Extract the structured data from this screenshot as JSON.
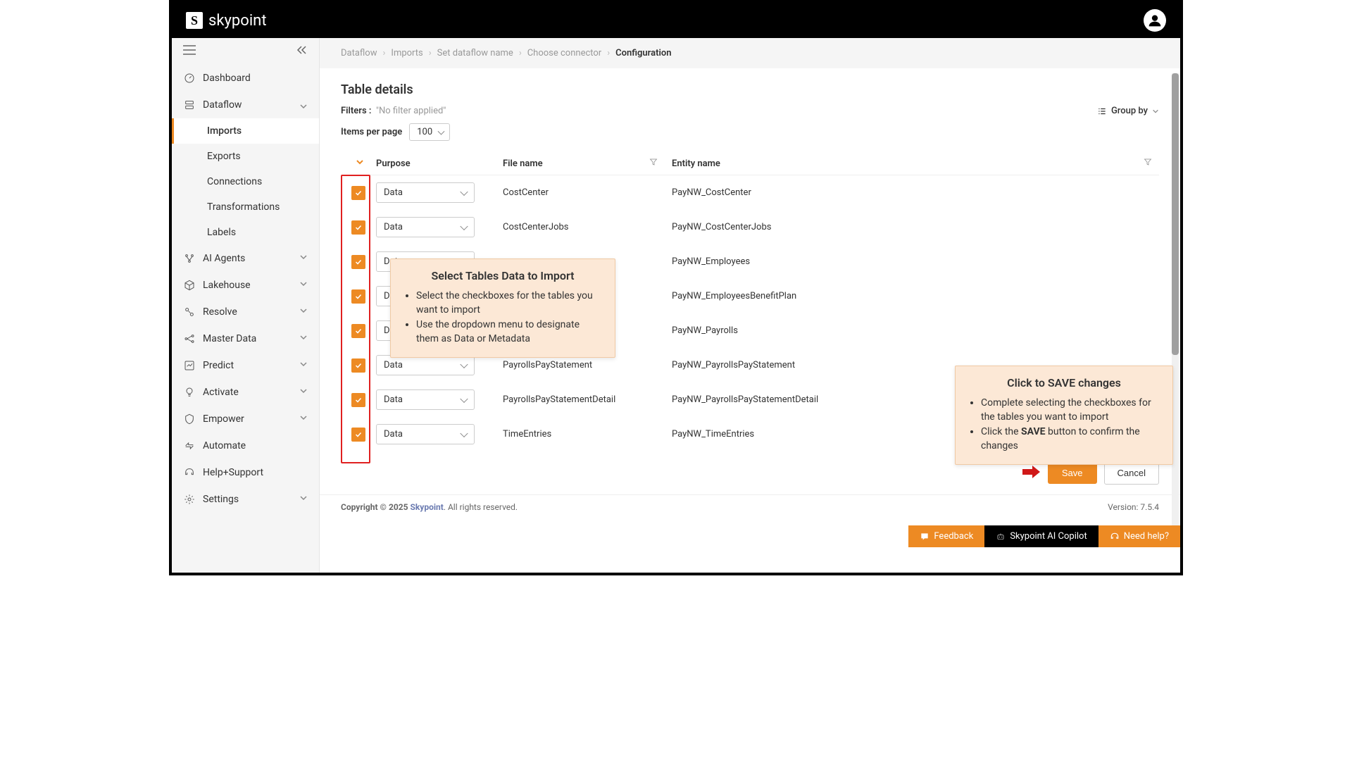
{
  "brand": "skypoint",
  "sidebar": {
    "items": [
      {
        "label": "Dashboard"
      },
      {
        "label": "Dataflow",
        "expanded": true,
        "children": [
          {
            "label": "Imports",
            "active": true
          },
          {
            "label": "Exports"
          },
          {
            "label": "Connections"
          },
          {
            "label": "Transformations"
          },
          {
            "label": "Labels"
          }
        ]
      },
      {
        "label": "AI Agents"
      },
      {
        "label": "Lakehouse"
      },
      {
        "label": "Resolve"
      },
      {
        "label": "Master Data"
      },
      {
        "label": "Predict"
      },
      {
        "label": "Activate"
      },
      {
        "label": "Empower"
      },
      {
        "label": "Automate"
      },
      {
        "label": "Help+Support"
      },
      {
        "label": "Settings"
      }
    ]
  },
  "breadcrumb": [
    {
      "label": "Dataflow"
    },
    {
      "label": "Imports"
    },
    {
      "label": "Set dataflow name"
    },
    {
      "label": "Choose connector"
    },
    {
      "label": "Configuration",
      "active": true
    }
  ],
  "page_title": "Table details",
  "filters": {
    "label": "Filters :",
    "value": "\"No filter applied\""
  },
  "group_by": "Group by",
  "items_per_page": {
    "label": "Items per page",
    "value": "100"
  },
  "columns": {
    "purpose": "Purpose",
    "file_name": "File name",
    "entity_name": "Entity name"
  },
  "rows": [
    {
      "checked": true,
      "purpose": "Data",
      "file_name": "CostCenter",
      "entity_name": "PayNW_CostCenter"
    },
    {
      "checked": true,
      "purpose": "Data",
      "file_name": "CostCenterJobs",
      "entity_name": "PayNW_CostCenterJobs"
    },
    {
      "checked": true,
      "purpose": "Data",
      "file_name": "",
      "entity_name": "PayNW_Employees"
    },
    {
      "checked": true,
      "purpose": "Data",
      "file_name": "",
      "entity_name": "PayNW_EmployeesBenefitPlan"
    },
    {
      "checked": true,
      "purpose": "Data",
      "file_name": "",
      "entity_name": "PayNW_Payrolls"
    },
    {
      "checked": true,
      "purpose": "Data",
      "file_name": "PayrollsPayStatement",
      "entity_name": "PayNW_PayrollsPayStatement"
    },
    {
      "checked": true,
      "purpose": "Data",
      "file_name": "PayrollsPayStatementDetail",
      "entity_name": "PayNW_PayrollsPayStatementDetail"
    },
    {
      "checked": true,
      "purpose": "Data",
      "file_name": "TimeEntries",
      "entity_name": "PayNW_TimeEntries"
    }
  ],
  "callout1": {
    "title": "Select Tables Data to Import",
    "bullets": [
      "Select the checkboxes for the tables you want to import",
      "Use the dropdown menu to designate them as Data or Metadata"
    ]
  },
  "callout2": {
    "title": "Click to SAVE changes",
    "bullets": [
      "Complete selecting the checkboxes for the tables you want to import",
      "Click the SAVE button to confirm the changes"
    ],
    "bold_word": "SAVE"
  },
  "actions": {
    "save": "Save",
    "cancel": "Cancel"
  },
  "float": {
    "feedback": "Feedback",
    "copilot": "Skypoint AI Copilot",
    "help": "Need help?"
  },
  "footer": {
    "copyright_prefix": "Copyright © 2025 ",
    "brand_link": "Skypoint",
    "suffix": ". All rights reserved.",
    "version": "Version: 7.5.4"
  }
}
